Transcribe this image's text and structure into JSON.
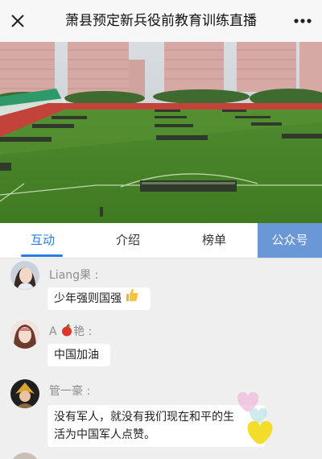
{
  "header": {
    "title": "萧县预定新兵役前教育训练直播",
    "close_icon": "close-icon",
    "more_icon": "more-icon"
  },
  "video": {
    "description_icon": "live-video"
  },
  "tabs": {
    "items": [
      {
        "label": "互动",
        "active": true
      },
      {
        "label": "介绍",
        "active": false
      },
      {
        "label": "榜单",
        "active": false
      }
    ],
    "official_label": "公众号",
    "active_color": "#2b7be4",
    "official_bg": "#6a98d7"
  },
  "chat": {
    "messages": [
      {
        "user_prefix": "Liang果",
        "user_suffix": " :",
        "text": "少年强则国强"
      },
      {
        "user_prefix": "A ",
        "user_mid": "艳",
        "user_suffix": " :",
        "text": "中国加油"
      },
      {
        "user_prefix": "管一豪",
        "user_suffix": " :",
        "text_line1": "没有军人，就没有我们现在和平的生",
        "text_line2": "活为中国军人点赞。"
      }
    ]
  }
}
